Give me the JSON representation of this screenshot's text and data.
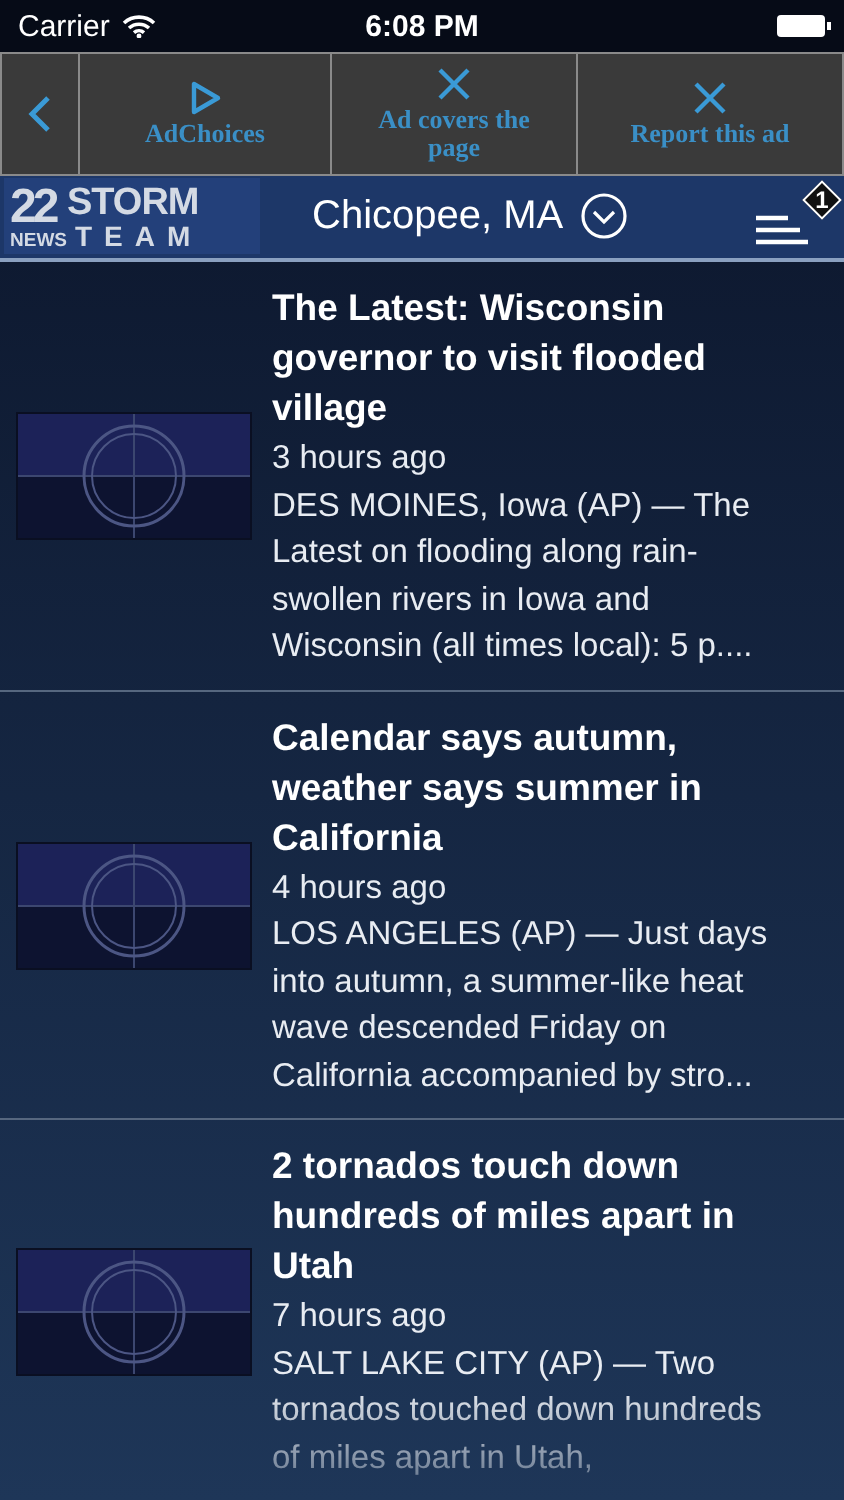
{
  "status_bar": {
    "carrier": "Carrier",
    "time": "6:08 PM"
  },
  "ad_bar": [
    {
      "kind": "back"
    },
    {
      "kind": "adchoices",
      "label": "AdChoices"
    },
    {
      "kind": "close",
      "label": "Ad covers the page"
    },
    {
      "kind": "close",
      "label": "Report this ad"
    }
  ],
  "header": {
    "logo": {
      "number": "22",
      "top": "STORM",
      "left": "NEWS",
      "bottom": "TEAM"
    },
    "location": "Chicopee, MA",
    "menu_badge": "1"
  },
  "articles": [
    {
      "title": "The Latest: Wisconsin governor to visit flooded village",
      "time": "3 hours ago",
      "summary": "DES MOINES, Iowa (AP) — The Latest on flooding along rain-swollen rivers in Iowa and Wisconsin (all times local): 5 p...."
    },
    {
      "title": "Calendar says autumn, weather says summer in California",
      "time": "4 hours ago",
      "summary": "LOS ANGELES (AP) — Just days into autumn, a summer-like heat wave descended Friday on California accompanied by stro..."
    },
    {
      "title": "2 tornados touch down hundreds of miles apart in Utah",
      "time": "7 hours ago",
      "summary": "SALT LAKE CITY (AP) — Two tornados touched down hundreds of miles apart in Utah,"
    }
  ]
}
